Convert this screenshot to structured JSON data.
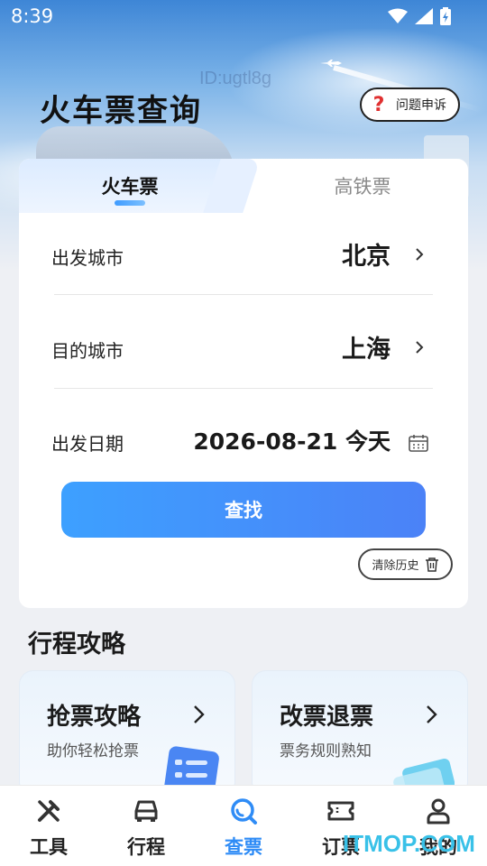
{
  "status_bar": {
    "time": "8:39"
  },
  "watermark_top": "ID:ugtl8g",
  "header": {
    "title": "火车票查询",
    "report_label": "问题申诉"
  },
  "tabs": [
    {
      "label": "火车票",
      "active": true
    },
    {
      "label": "高铁票",
      "active": false
    }
  ],
  "form": {
    "departure": {
      "label": "出发城市",
      "value": "北京"
    },
    "destination": {
      "label": "目的城市",
      "value": "上海"
    },
    "date": {
      "label": "出发日期",
      "value": "2026-08-21 今天"
    },
    "search_label": "查找",
    "clear_history_label": "清除历史"
  },
  "guides": {
    "section_title": "行程攻略",
    "items": [
      {
        "title": "抢票攻略",
        "subtitle": "助你轻松抢票"
      },
      {
        "title": "改票退票",
        "subtitle": "票务规则熟知"
      }
    ]
  },
  "bottom_nav": [
    {
      "label": "工具",
      "icon": "tools-icon",
      "active": false
    },
    {
      "label": "行程",
      "icon": "car-icon",
      "active": false
    },
    {
      "label": "查票",
      "icon": "search-icon",
      "active": true
    },
    {
      "label": "订票",
      "icon": "ticket-icon",
      "active": false
    },
    {
      "label": "我的",
      "icon": "user-icon",
      "active": false
    }
  ],
  "watermark_bottom": "ITMOP.COM",
  "colors": {
    "accent": "#2f8cf6",
    "search_button_start": "#3da0ff",
    "search_button_end": "#4b82f7",
    "watermark": "#39c1e8"
  }
}
